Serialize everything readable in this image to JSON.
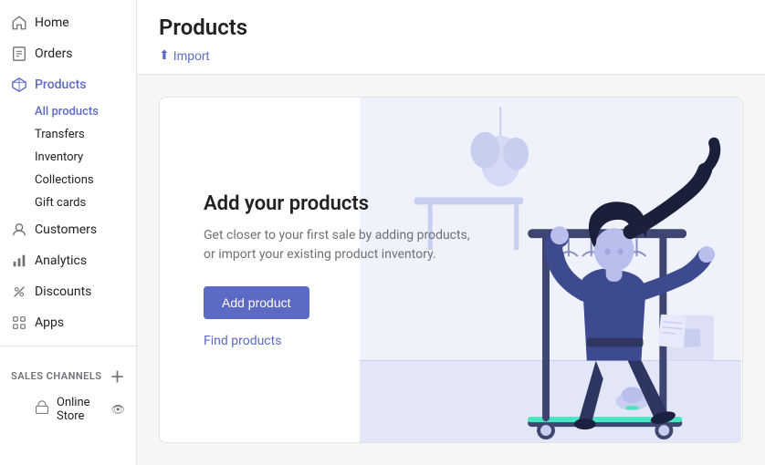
{
  "sidebar": {
    "main_items": [
      {
        "id": "home",
        "label": "Home",
        "icon": "🏠",
        "active": false
      },
      {
        "id": "orders",
        "label": "Orders",
        "icon": "📋",
        "active": false
      },
      {
        "id": "products",
        "label": "Products",
        "icon": "🏷",
        "active": true
      }
    ],
    "products_sub": [
      {
        "id": "all-products",
        "label": "All products",
        "active": true
      },
      {
        "id": "transfers",
        "label": "Transfers",
        "active": false
      },
      {
        "id": "inventory",
        "label": "Inventory",
        "active": false
      },
      {
        "id": "collections",
        "label": "Collections",
        "active": false
      },
      {
        "id": "gift-cards",
        "label": "Gift cards",
        "active": false
      }
    ],
    "bottom_items": [
      {
        "id": "customers",
        "label": "Customers",
        "icon": "👤",
        "active": false
      },
      {
        "id": "analytics",
        "label": "Analytics",
        "icon": "📊",
        "active": false
      },
      {
        "id": "discounts",
        "label": "Discounts",
        "icon": "🏷",
        "active": false
      },
      {
        "id": "apps",
        "label": "Apps",
        "icon": "🔲",
        "active": false
      }
    ],
    "sales_channels": {
      "title": "SALES CHANNELS",
      "online_store": "Online Store"
    }
  },
  "header": {
    "title": "Products",
    "import_label": "Import"
  },
  "main": {
    "heading": "Add your products",
    "description": "Get closer to your first sale by adding products, or import your existing product inventory.",
    "add_button": "Add product",
    "find_link": "Find products"
  },
  "colors": {
    "accent": "#5c6ac4",
    "text_primary": "#202223",
    "text_secondary": "#6d7175",
    "border": "#e1e3e5",
    "bg": "#f6f6f7",
    "illus_light": "#e8eafc",
    "illus_mid": "#c4c9f5",
    "illus_body": "#3d4a8f",
    "illus_teal": "#47e6c0"
  }
}
